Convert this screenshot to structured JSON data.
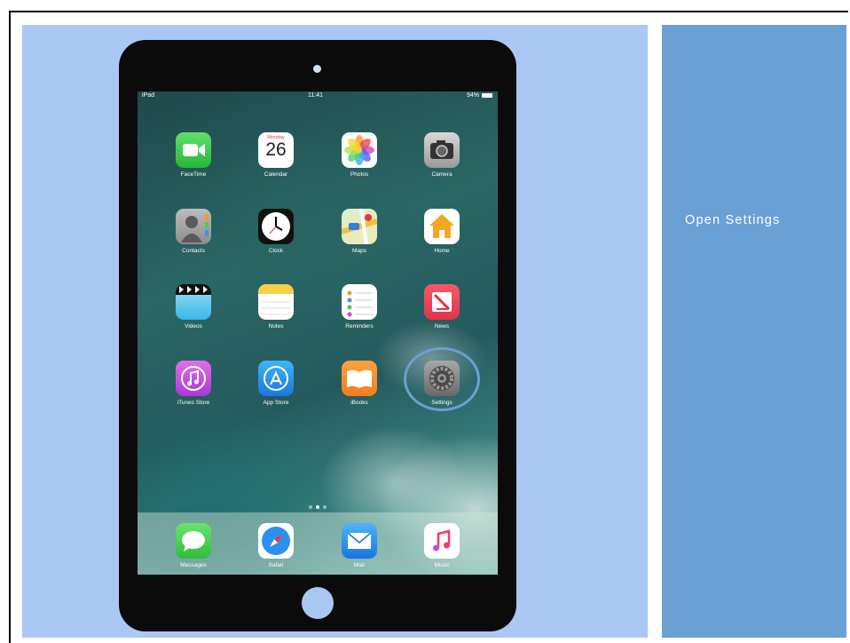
{
  "instruction": {
    "text": "Open Settings"
  },
  "status_bar": {
    "carrier": "iPad",
    "time": "11:41",
    "battery": "94%"
  },
  "apps": [
    {
      "label": "FaceTime",
      "icon": "facetime-icon"
    },
    {
      "label": "Calendar",
      "icon": "calendar-icon",
      "weekday": "Monday",
      "day": "26"
    },
    {
      "label": "Photos",
      "icon": "photos-icon"
    },
    {
      "label": "Camera",
      "icon": "camera-icon"
    },
    {
      "label": "Contacts",
      "icon": "contacts-icon"
    },
    {
      "label": "Clock",
      "icon": "clock-icon"
    },
    {
      "label": "Maps",
      "icon": "maps-icon"
    },
    {
      "label": "Home",
      "icon": "home-icon"
    },
    {
      "label": "Videos",
      "icon": "videos-icon"
    },
    {
      "label": "Notes",
      "icon": "notes-icon"
    },
    {
      "label": "Reminders",
      "icon": "reminders-icon"
    },
    {
      "label": "News",
      "icon": "news-icon"
    },
    {
      "label": "iTunes Store",
      "icon": "itunes-store-icon"
    },
    {
      "label": "App Store",
      "icon": "app-store-icon"
    },
    {
      "label": "iBooks",
      "icon": "ibooks-icon"
    },
    {
      "label": "Settings",
      "icon": "settings-icon"
    }
  ],
  "dock": [
    {
      "label": "Messages",
      "icon": "messages-icon"
    },
    {
      "label": "Safari",
      "icon": "safari-icon"
    },
    {
      "label": "Mail",
      "icon": "mail-icon"
    },
    {
      "label": "Music",
      "icon": "music-icon"
    }
  ],
  "colors": {
    "left_panel": "#abc8f4",
    "right_panel": "#6aa0d4",
    "highlight": "#6aa0d4"
  }
}
